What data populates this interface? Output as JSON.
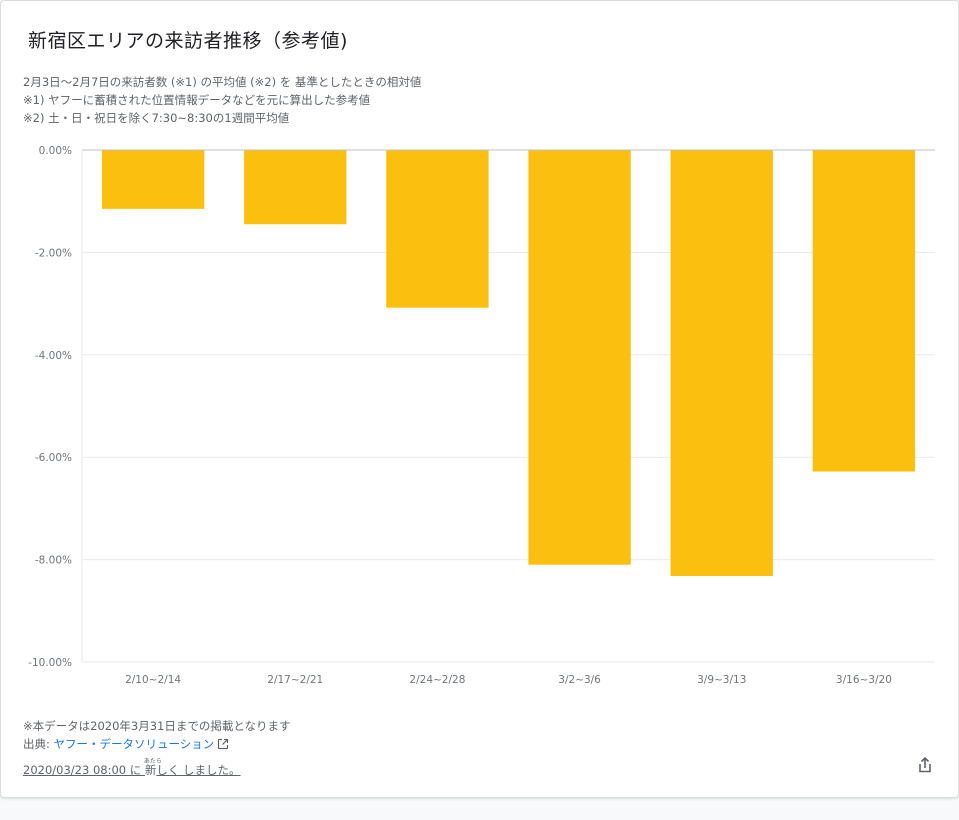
{
  "card": {
    "title": "新宿区エリアの来訪者推移（参考値)",
    "notes": [
      "2月3日〜2月7日の来訪者数 (※1) の平均値 (※2) を 基準としたときの相対値",
      "※1) ヤフーに蓄積された位置情報データなどを元に算出した参考値",
      "※2) 土・日・祝日を除く7:30~8:30の1週間平均値"
    ]
  },
  "chart_data": {
    "type": "bar",
    "title": "",
    "xlabel": "",
    "ylabel": "",
    "categories": [
      "2/10~2/14",
      "2/17~2/21",
      "2/24~2/28",
      "3/2~3/6",
      "3/9~3/13",
      "3/16~3/20"
    ],
    "values": [
      -1.15,
      -1.45,
      -3.08,
      -8.1,
      -8.32,
      -6.28
    ],
    "ylim": [
      -10,
      0
    ],
    "yticks": [
      0,
      -2,
      -4,
      -6,
      -8,
      -10
    ],
    "ytick_labels": [
      "0.00%",
      "-2.00%",
      "-4.00%",
      "-6.00%",
      "-8.00%",
      "-10.00%"
    ],
    "grid": true,
    "bar_color": "#fbc00f",
    "grid_color": "#e8eaed",
    "axis_color": "#bdc1c6",
    "label_color": "#70757a"
  },
  "footer": {
    "disclaimer": "※本データは2020年3月31日までの掲載となります",
    "source_prefix": "出典: ",
    "source_link": "ヤフー・データソリューション",
    "updated_prefix": "2020/03/23 08:00 に ",
    "updated_kanji": "新",
    "updated_furigana": "あたら",
    "updated_suffix": "しく しました。"
  },
  "icons": {
    "external_link": "external-link-icon",
    "share": "share-icon"
  }
}
